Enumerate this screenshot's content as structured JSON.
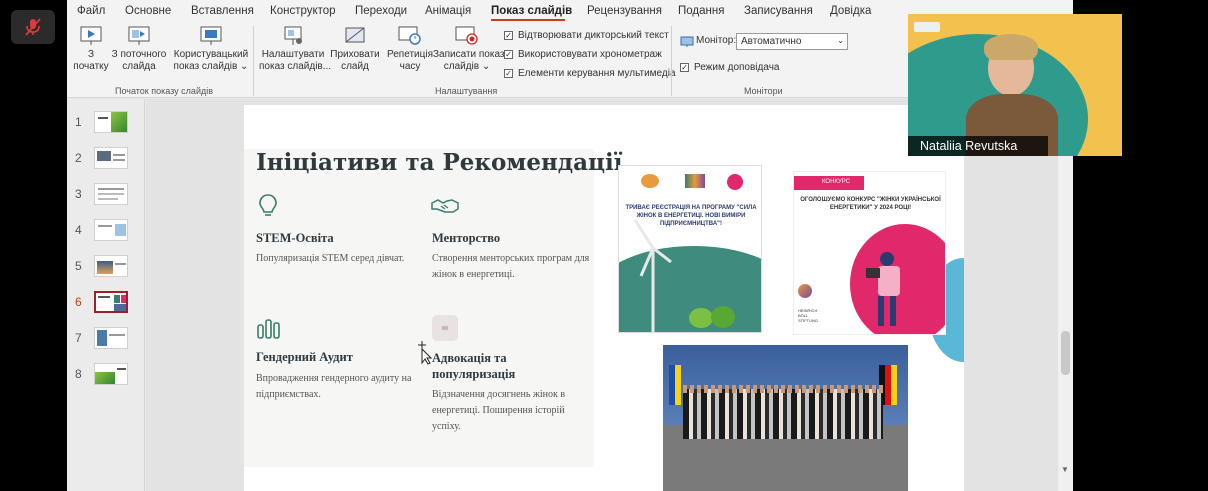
{
  "menu": {
    "items": [
      "Файл",
      "Основне",
      "Вставлення",
      "Конструктор",
      "Переходи",
      "Анімація",
      "Показ слайдів",
      "Рецензування",
      "Подання",
      "Записування",
      "Довідка"
    ],
    "active": "Показ слайдів"
  },
  "ribbon": {
    "from_start_line1": "З",
    "from_start_line2": "початку",
    "from_current_line1": "З поточного",
    "from_current_line2": "слайда",
    "custom_line1": "Користувацький",
    "custom_line2": "показ слайдів ⌄",
    "group_start": "Початок показу слайдів",
    "setup_line1": "Налаштувати",
    "setup_line2": "показ слайдів...",
    "hide_line1": "Приховати",
    "hide_line2": "слайд",
    "rehearse_line1": "Репетиція",
    "rehearse_line2": "часу",
    "record_line1": "Записати показ",
    "record_line2": "слайдів ⌄",
    "chk_narration": "Відтворювати дикторський текст",
    "chk_timings": "Використовувати хронометраж",
    "chk_media": "Елементи керування мультимедіа",
    "group_setup": "Налаштування",
    "monitor_label": "Монітор:",
    "monitor_value": "Автоматично",
    "presenter_view": "Режим доповідача",
    "group_monitors": "Монітори"
  },
  "thumbnails": {
    "numbers": [
      "1",
      "2",
      "3",
      "4",
      "5",
      "6",
      "7",
      "8"
    ],
    "selected": "6"
  },
  "slide": {
    "title": "Ініціативи та Рекомендації",
    "features": [
      {
        "title": "STEM-Освіта",
        "text": "Популяризація STEM серед дівчат.",
        "icon": "lightbulb-icon"
      },
      {
        "title": "Менторство",
        "text": "Створення менторських програм для жінок в енергетиці.",
        "icon": "handshake-icon"
      },
      {
        "title": "Гендерний Аудит",
        "text": "Впровадження гендерного аудиту на підприємствах.",
        "icon": "bar-chart-icon"
      },
      {
        "title": "Адвокація та популяризація",
        "text": "Відзначення досягнень жінок в енергетиці. Поширення історій успіху.",
        "icon": "image-icon"
      }
    ],
    "poster1_text": "ТРИВАЄ РЕЄСТРАЦІЯ НА ПРОГРАМУ \"СИЛА ЖІНОК В ЕНЕРГЕТИЦІ. НОВІ ВИМІРИ ПІДПРИЄМНИЦТВА\"!",
    "poster2_tag": "КОНКУРС",
    "poster2_text": "ОГОЛОШУЄМО КОНКУРС \"ЖІНКИ УКРАЇНСЬКОЇ ЕНЕРГЕТИКИ\" У 2024 РОЦІ!",
    "poster2_logo": "HEINRICH BÖLL STIFTUNG"
  },
  "video": {
    "participant_name": "Nataliia Revutska"
  },
  "colors": {
    "accent": "#c43e1c",
    "blob": "#5ab8d6",
    "selected_thumb": "#a0202a"
  }
}
